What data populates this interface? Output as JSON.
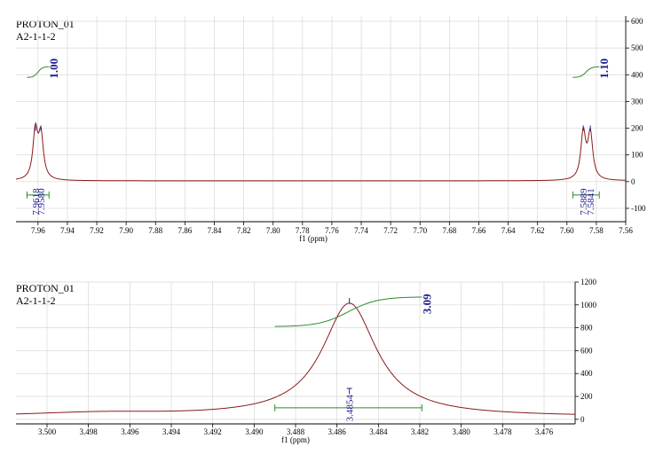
{
  "colors": {
    "spectrum": "#8b1a1a",
    "integral": "#2e8b2e",
    "peak_label": "#1f1f8f",
    "grid": "#d8d8d8",
    "axis": "#000000"
  },
  "chart_data": [
    {
      "type": "line",
      "title_lines": [
        "PROTON_01",
        "A2-1-1-2"
      ],
      "xlabel": "f1 (ppm)",
      "x_reversed": true,
      "xlim": [
        7.975,
        7.56
      ],
      "ylim": [
        -150,
        620
      ],
      "xticks": [
        "7.96",
        "7.94",
        "7.92",
        "7.90",
        "7.88",
        "7.86",
        "7.84",
        "7.82",
        "7.80",
        "7.78",
        "7.76",
        "7.74",
        "7.72",
        "7.70",
        "7.68",
        "7.66",
        "7.64",
        "7.62",
        "7.60",
        "7.58",
        "7.56"
      ],
      "yticks": [
        "-100",
        "0",
        "100",
        "200",
        "300",
        "400",
        "500",
        "600"
      ],
      "grid": true,
      "peaks": [
        {
          "x": 7.9618,
          "height": 180,
          "width": 0.002
        },
        {
          "x": 7.958,
          "height": 160,
          "width": 0.002
        },
        {
          "x": 7.5889,
          "height": 175,
          "width": 0.002
        },
        {
          "x": 7.5841,
          "height": 170,
          "width": 0.002
        }
      ],
      "baseline": 3,
      "peak_labels": [
        {
          "text": "7.9618",
          "x": 7.9618
        },
        {
          "text": "7.9580",
          "x": 7.958
        },
        {
          "text": "7.5889",
          "x": 7.5889
        },
        {
          "text": "7.5841",
          "x": 7.5841
        }
      ],
      "integrals": [
        {
          "value": "1.00",
          "from": 7.9675,
          "to": 7.9525
        },
        {
          "value": "1.10",
          "from": 7.596,
          "to": 7.578
        }
      ]
    },
    {
      "type": "line",
      "title_lines": [
        "PROTON_01",
        "A2-1-1-2"
      ],
      "xlabel": "f1 (ppm)",
      "x_reversed": true,
      "xlim": [
        3.5015,
        3.4745
      ],
      "ylim": [
        -40,
        1200
      ],
      "xticks": [
        "3.500",
        "3.498",
        "3.496",
        "3.494",
        "3.492",
        "3.490",
        "3.488",
        "3.486",
        "3.484",
        "3.482",
        "3.480",
        "3.478",
        "3.476"
      ],
      "yticks": [
        "0",
        "200",
        "400",
        "600",
        "800",
        "1000",
        "1200"
      ],
      "grid": true,
      "peaks": [
        {
          "x": 3.4854,
          "height": 990,
          "width": 0.0016
        },
        {
          "x": 3.4975,
          "height": 30,
          "width": 0.004
        }
      ],
      "baseline": 22,
      "peak_labels": [
        {
          "text": "3.4854",
          "x": 3.4854
        }
      ],
      "integrals": [
        {
          "value": "3.09",
          "from": 3.489,
          "to": 3.4819
        }
      ]
    }
  ]
}
